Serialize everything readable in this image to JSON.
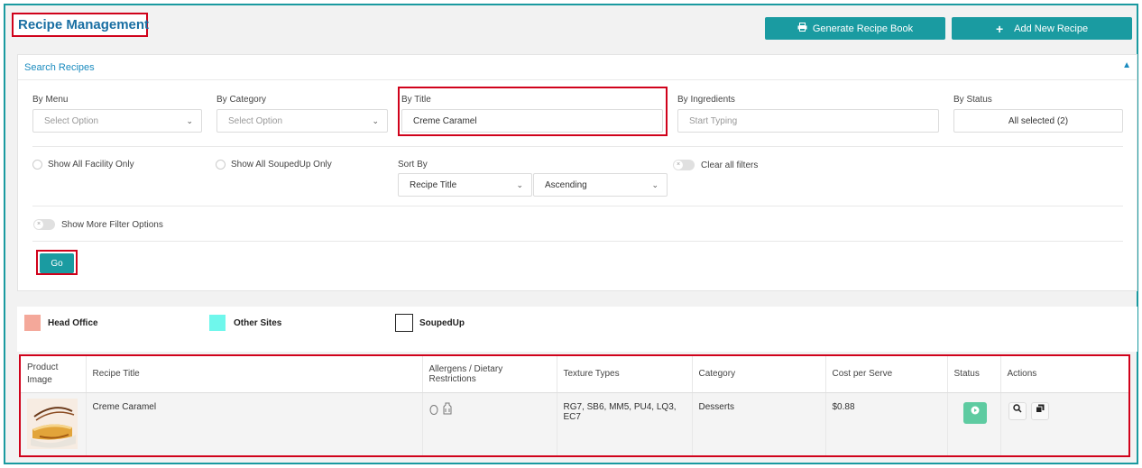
{
  "page": {
    "title": "Recipe Management",
    "generate_button": "Generate Recipe Book",
    "add_button": "Add New Recipe"
  },
  "search": {
    "header": "Search Recipes",
    "by_menu": {
      "label": "By Menu",
      "placeholder": "Select Option"
    },
    "by_category": {
      "label": "By Category",
      "placeholder": "Select Option"
    },
    "by_title": {
      "label": "By Title",
      "value": "Creme Caramel"
    },
    "by_ingredients": {
      "label": "By Ingredients",
      "placeholder": "Start Typing"
    },
    "by_status": {
      "label": "By Status",
      "value": "All selected (2)"
    },
    "show_facility": "Show All Facility Only",
    "show_soupedup": "Show All SoupedUp Only",
    "sort_by": {
      "label": "Sort By",
      "field": "Recipe Title",
      "order": "Ascending"
    },
    "clear_filters": "Clear all filters",
    "more_filters": "Show More Filter Options",
    "go_button": "Go"
  },
  "legend": [
    {
      "label": "Head Office",
      "color": "#f4a89a"
    },
    {
      "label": "Other Sites",
      "color": "#6ff7ec"
    },
    {
      "label": "SoupedUp",
      "color": "#ffffff"
    }
  ],
  "table": {
    "headers": [
      "Product Image",
      "Recipe Title",
      "Allergens / Dietary Restrictions",
      "Texture Types",
      "Category",
      "Cost per Serve",
      "Status",
      "Actions"
    ],
    "rows": [
      {
        "title": "Creme Caramel",
        "allergen_icons": [
          "egg-icon",
          "milk-icon"
        ],
        "texture": "RG7, SB6, MM5, PU4, LQ3, EC7",
        "category": "Desserts",
        "cost": "$0.88"
      }
    ]
  },
  "colors": {
    "accent": "#1a9ba1",
    "highlight": "#d0021b",
    "status_active": "#5ecba1"
  }
}
